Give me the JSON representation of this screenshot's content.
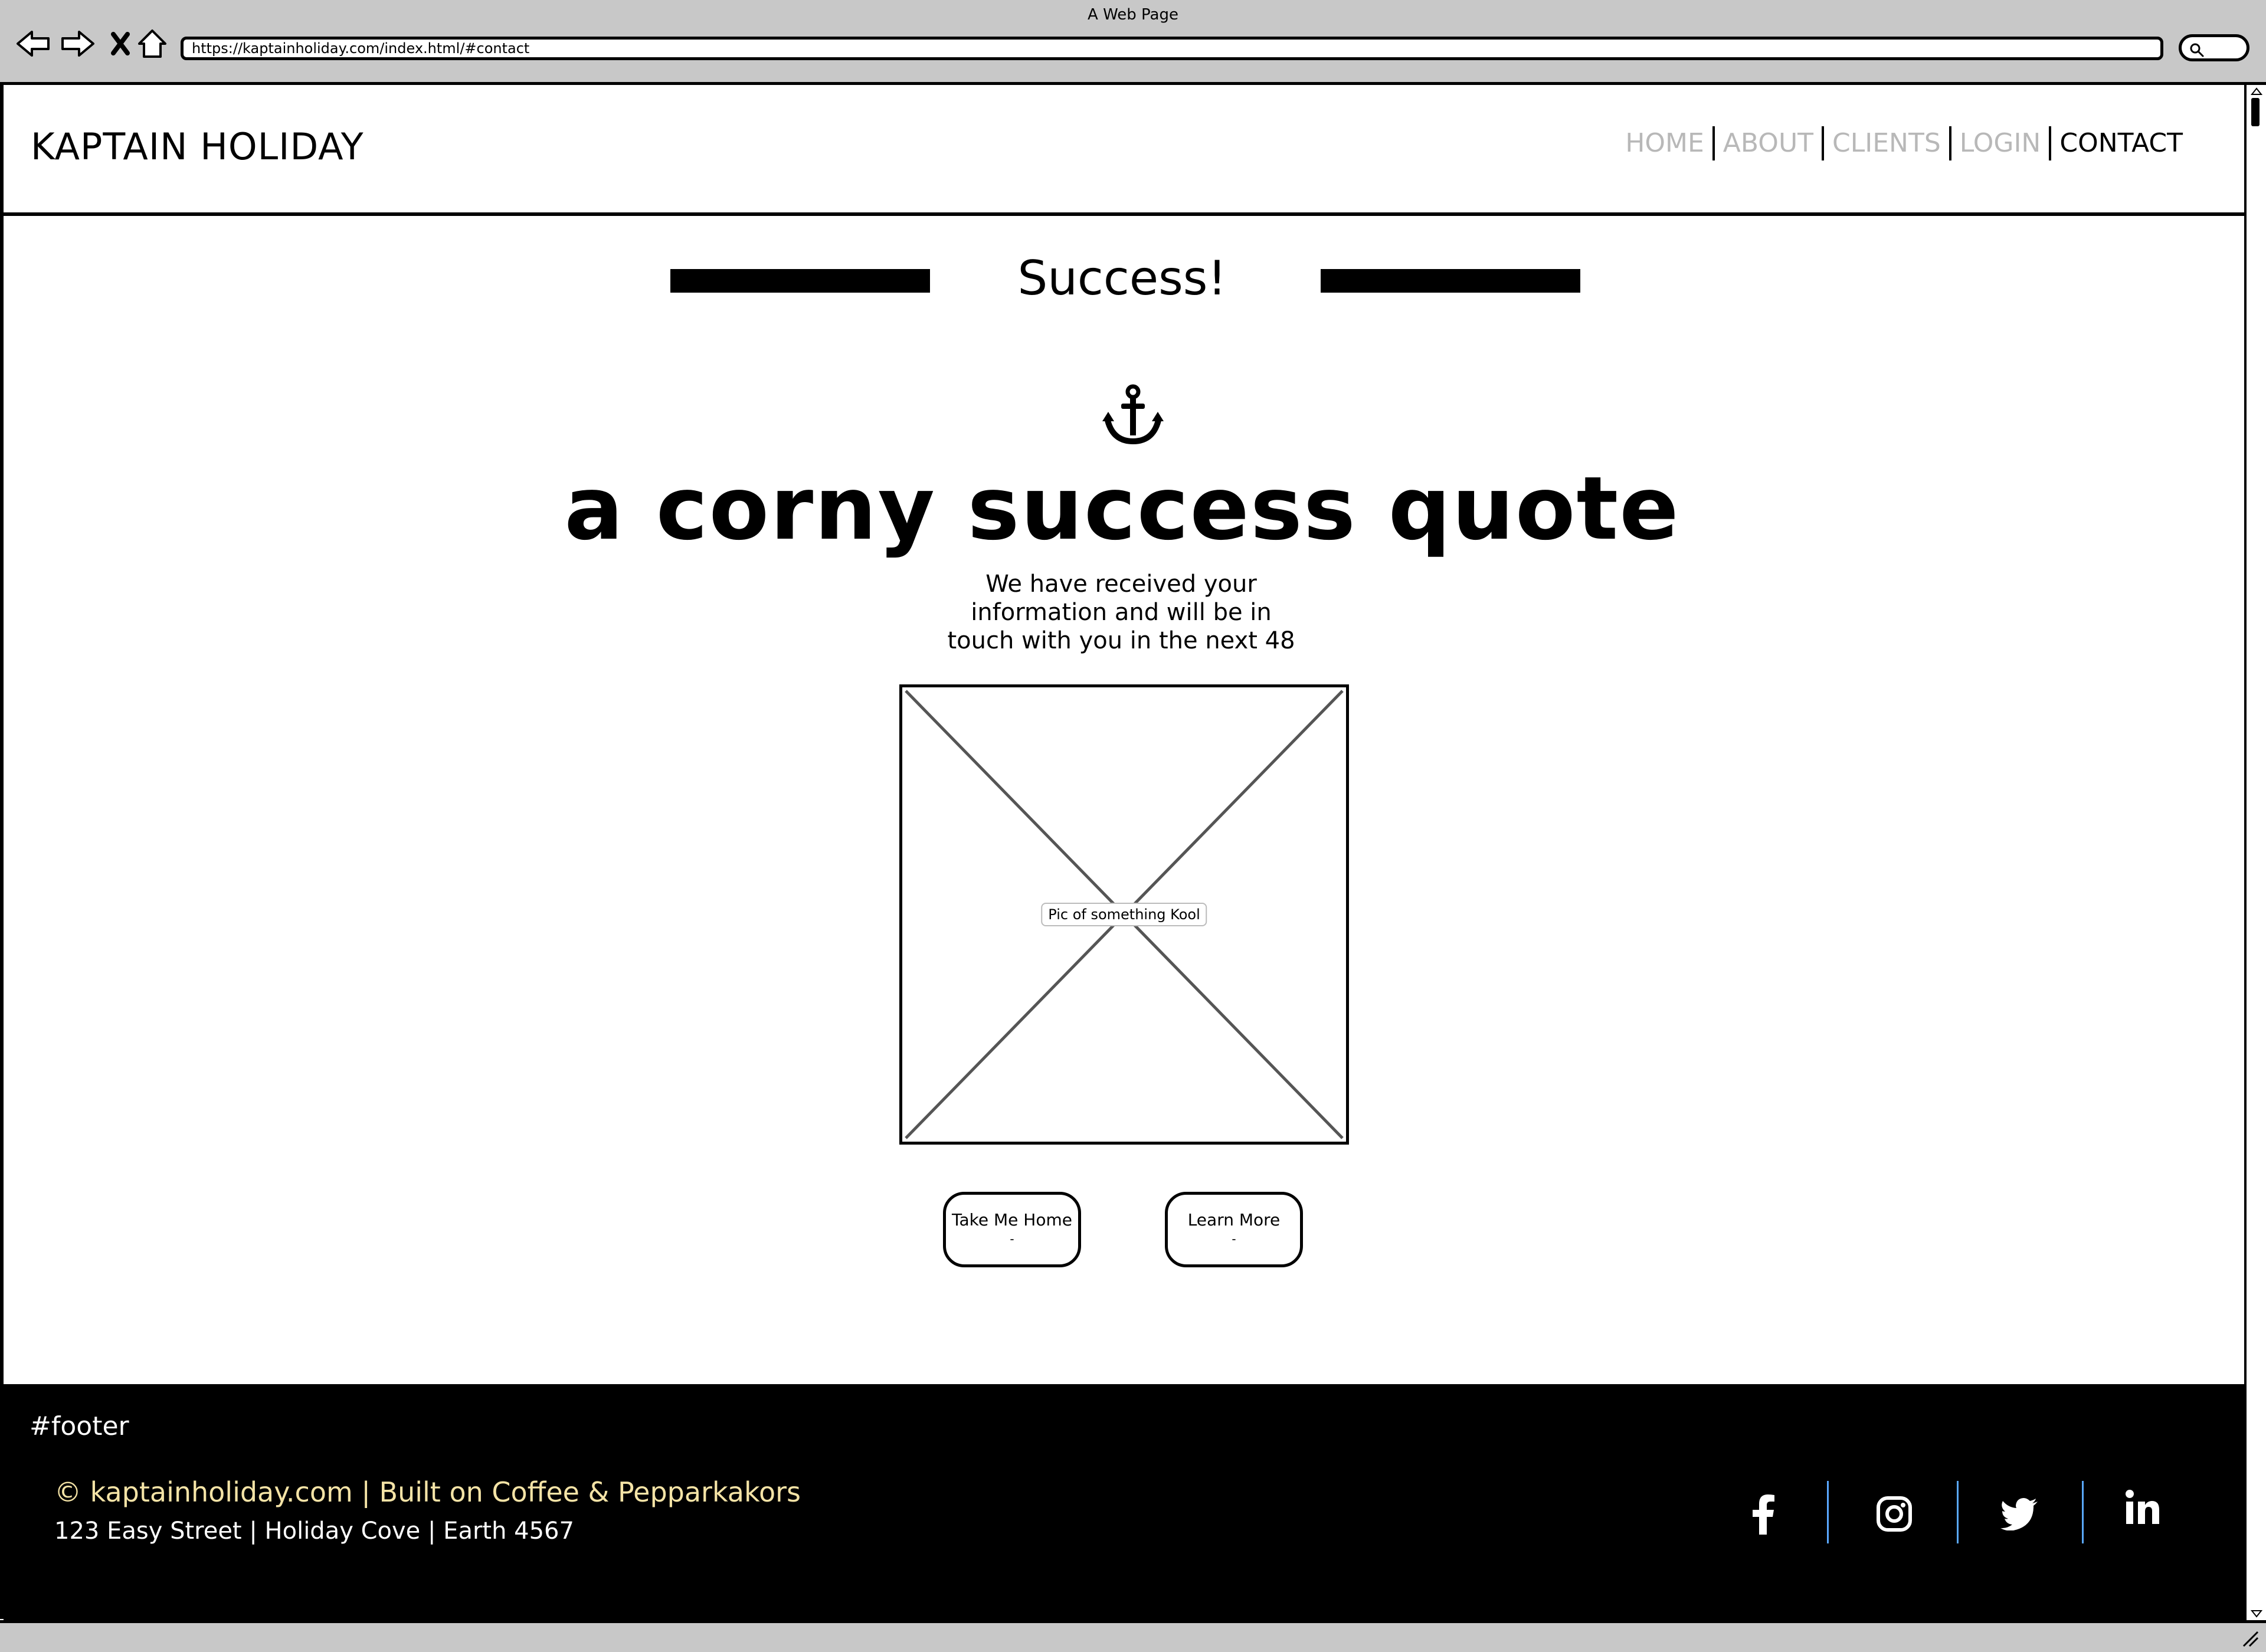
{
  "browser": {
    "window_title": "A Web Page",
    "url": "https://kaptainholiday.com/index.html/#contact"
  },
  "header": {
    "brand": "KAPTAIN HOLIDAY",
    "nav": [
      {
        "label": "HOME",
        "active": false
      },
      {
        "label": "ABOUT",
        "active": false
      },
      {
        "label": "CLIENTS",
        "active": false
      },
      {
        "label": "LOGIN",
        "active": false
      },
      {
        "label": "CONTACT",
        "active": true
      }
    ]
  },
  "main": {
    "title": "Success!",
    "icon": "anchor-icon",
    "quote": "a corny success quote",
    "message_lines": [
      "We have received your",
      "information and will be in",
      "touch with you in the next 48"
    ],
    "image_placeholder_label": "Pic of something Kool",
    "buttons": [
      {
        "label": "Take Me Home",
        "sub": "-"
      },
      {
        "label": "Learn More",
        "sub": "-"
      }
    ]
  },
  "footer": {
    "tag": "#footer",
    "copyright": "© kaptainholiday.com | Built on Coffee & Pepparkakors",
    "address": "123 Easy Street | Holiday Cove | Earth 4567",
    "social": [
      "facebook-icon",
      "instagram-icon",
      "twitter-icon",
      "linkedin-icon"
    ]
  },
  "colors": {
    "chrome": "#c8c8c8",
    "nav_inactive": "#b8b8b8",
    "footer_bg": "#000000",
    "copyright_text": "#f4e3a6",
    "social_separator": "#5aa8ff"
  }
}
